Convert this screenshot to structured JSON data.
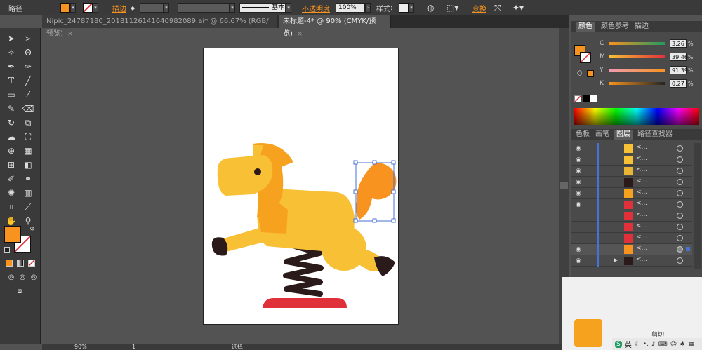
{
  "control_bar": {
    "object_type": "路径",
    "stroke_label": "描边",
    "stroke_profile": "基本",
    "opacity_label": "不透明度",
    "opacity_value": "100%",
    "style_label": "样式",
    "transform_label": "变换",
    "fill_color": "#f7931e"
  },
  "document_tabs": [
    {
      "label": "Nipic_24787180_20181126141640982089.ai* @ 66.67% (RGB/预览)",
      "active": false
    },
    {
      "label": "未标题-4* @ 90% (CMYK/预览)",
      "active": true
    }
  ],
  "tools": {
    "fill_color": "#f7931e",
    "stroke_color": "#ffffff"
  },
  "color_panel": {
    "tabs": [
      "颜色",
      "颜色参考",
      "描边"
    ],
    "active_tab": "颜色",
    "sliders": [
      {
        "letter": "C",
        "value": "3.26",
        "unit": "%"
      },
      {
        "letter": "M",
        "value": "39.46",
        "unit": "%"
      },
      {
        "letter": "Y",
        "value": "91.39",
        "unit": "%"
      },
      {
        "letter": "K",
        "value": "0.27",
        "unit": "%"
      }
    ],
    "fill_color": "#f7931e"
  },
  "layers_panel": {
    "tabs": [
      "色板",
      "画笔",
      "图层",
      "路径查找器"
    ],
    "active_tab": "图层",
    "rows": [
      {
        "name": "<...",
        "visible": true,
        "thumb_color": "#f7c035"
      },
      {
        "name": "<...",
        "visible": true,
        "thumb_color": "#f7c035"
      },
      {
        "name": "<...",
        "visible": true,
        "thumb_color": "#e8b535"
      },
      {
        "name": "<...",
        "visible": true,
        "thumb_color": "#2b1a1a"
      },
      {
        "name": "<...",
        "visible": true,
        "thumb_color": "#f7a21e"
      },
      {
        "name": "<...",
        "visible": true,
        "thumb_color": "#e0303a"
      },
      {
        "name": "<...",
        "visible": false,
        "thumb_color": "#e0303a"
      },
      {
        "name": "<...",
        "visible": false,
        "thumb_color": "#e0303a"
      },
      {
        "name": "<...",
        "visible": false,
        "thumb_color": "#e0303a"
      },
      {
        "name": "<...",
        "visible": true,
        "thumb_color": "#f7931e"
      },
      {
        "name": "<...",
        "visible": true,
        "thumb_color": "#2b1a1a"
      }
    ]
  },
  "status_bar": {
    "zoom": "90%",
    "page": "1",
    "tool_label": "选择"
  },
  "overlay": {
    "ime_label": "英",
    "clip_label": "剪切"
  }
}
